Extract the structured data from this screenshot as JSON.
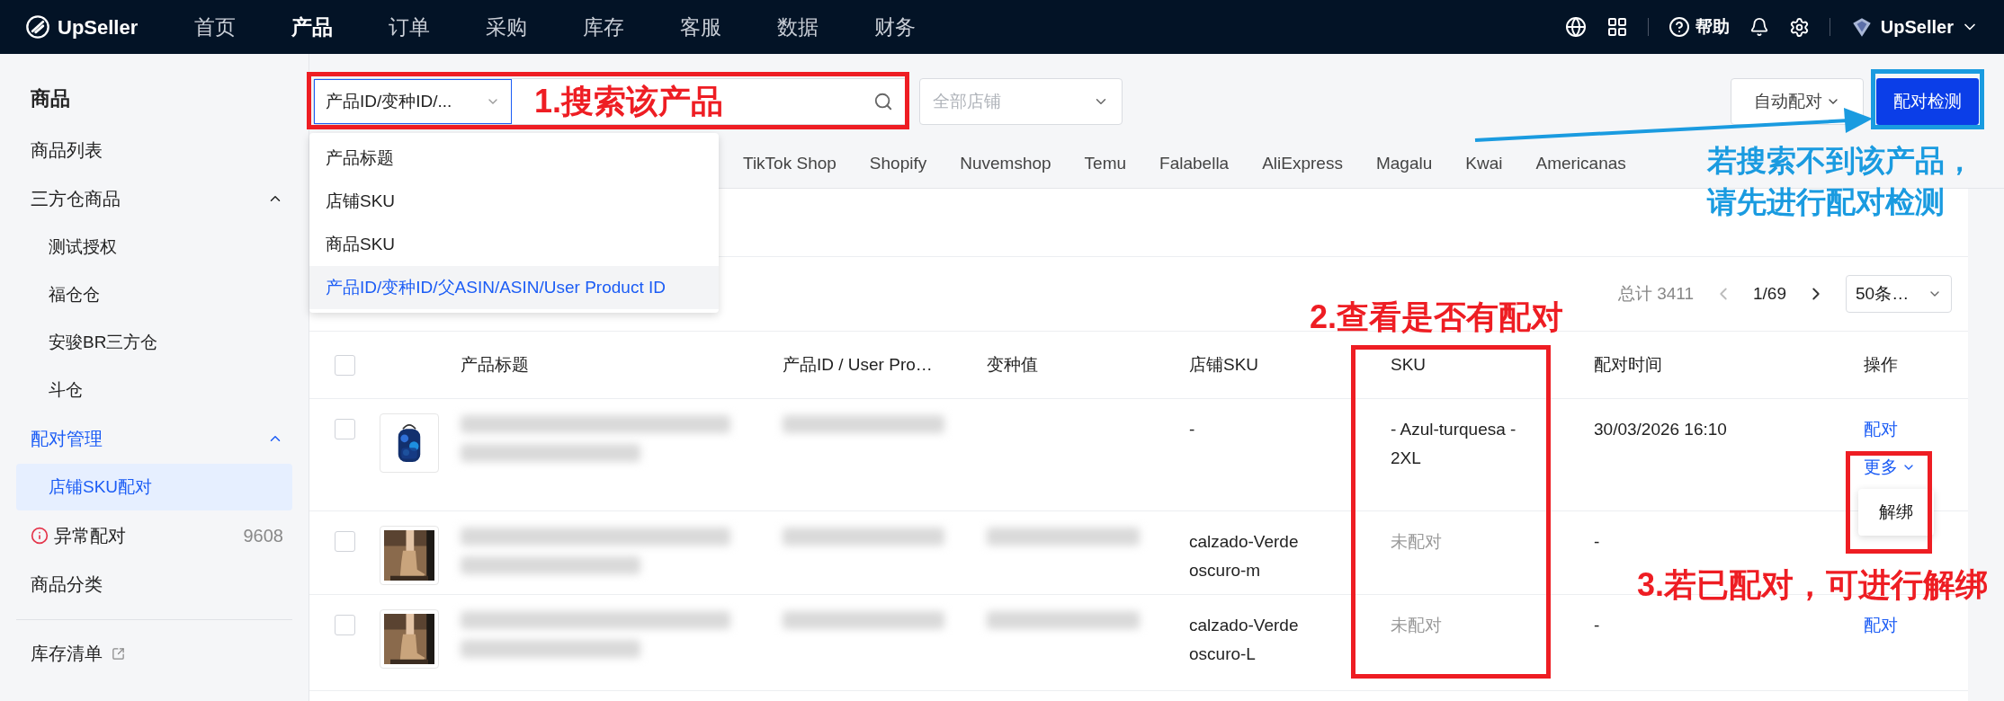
{
  "nav": {
    "logo": "UpSeller",
    "items": [
      {
        "label": "首页",
        "selected": false
      },
      {
        "label": "产品",
        "selected": true
      },
      {
        "label": "订单",
        "selected": false
      },
      {
        "label": "采购",
        "selected": false
      },
      {
        "label": "库存",
        "selected": false
      },
      {
        "label": "客服",
        "selected": false
      },
      {
        "label": "数据",
        "selected": false
      },
      {
        "label": "财务",
        "selected": false
      }
    ],
    "help": "帮助",
    "account": "UpSeller"
  },
  "sidebar": {
    "title": "商品",
    "items": [
      {
        "kind": "item",
        "label": "商品列表",
        "selected": false
      },
      {
        "kind": "group",
        "label": "三方仓商品",
        "selected": false,
        "expanded": true,
        "children": [
          {
            "label": "测试授权",
            "selected": false
          },
          {
            "label": "福仓仓",
            "selected": false
          },
          {
            "label": "安骏BR三方仓",
            "selected": false
          },
          {
            "label": "斗仓",
            "selected": false
          }
        ]
      },
      {
        "kind": "group",
        "label": "配对管理",
        "selected": true,
        "expanded": true,
        "children": [
          {
            "label": "店铺SKU配对",
            "selected": true
          }
        ]
      },
      {
        "kind": "alert",
        "label": "异常配对",
        "count": "9608",
        "selected": false
      },
      {
        "kind": "item",
        "label": "商品分类",
        "selected": false
      },
      {
        "kind": "link",
        "label": "库存清单",
        "selected": false
      }
    ]
  },
  "search": {
    "type_select": "产品ID/变种ID/...",
    "store_select": {
      "placeholder": "全部店铺"
    },
    "options": [
      {
        "label": "产品标题",
        "selected": false
      },
      {
        "label": "店铺SKU",
        "selected": false
      },
      {
        "label": "商品SKU",
        "selected": false
      },
      {
        "label": "产品ID/变种ID/父ASIN/ASIN/User Product ID",
        "selected": true
      }
    ]
  },
  "buttons": {
    "auto_pair": "自动配对",
    "pair_check": "配对检测"
  },
  "platform_tabs": [
    {
      "label": "TikTok Shop",
      "selected": false
    },
    {
      "label": "Shopify",
      "selected": false
    },
    {
      "label": "Nuvemshop",
      "selected": false
    },
    {
      "label": "Temu",
      "selected": false
    },
    {
      "label": "Falabella",
      "selected": false
    },
    {
      "label": "AliExpress",
      "selected": false
    },
    {
      "label": "Magalu",
      "selected": false
    },
    {
      "label": "Kwai",
      "selected": false
    },
    {
      "label": "Americanas",
      "selected": false
    }
  ],
  "pagination": {
    "total": "总计 3411",
    "page": "1/69",
    "page_size": "50条…"
  },
  "table": {
    "select_all": {
      "checked": false
    },
    "columns": [
      "产品标题",
      "产品ID / User Pro…",
      "变种值",
      "店铺SKU",
      "SKU",
      "配对时间",
      "操作"
    ],
    "rows": [
      {
        "checked": false,
        "thumbnail": {
          "kind": "picture"
        },
        "variant_blurred": false,
        "store_sku": "-",
        "sku": "- Azul-turquesa - 2XL",
        "paired": true,
        "paired_time": "30/03/2026 16:10",
        "actions": [
          {
            "label": "配对"
          }
        ],
        "more": {
          "label": "更多",
          "expanded": true,
          "menu": [
            {
              "label": "解绑"
            }
          ]
        }
      },
      {
        "checked": false,
        "thumbnail": {
          "kind": "picture"
        },
        "variant_blurred": true,
        "store_sku": "calzado-Verde oscuro-m",
        "sku": "未配对",
        "paired": false,
        "paired_time": "-",
        "actions": []
      },
      {
        "checked": false,
        "thumbnail": {
          "kind": "picture"
        },
        "variant_blurred": true,
        "store_sku": "calzado-Verde oscuro-L",
        "sku": "未配对",
        "paired": false,
        "paired_time": "-",
        "actions": [
          {
            "label": "配对"
          }
        ]
      }
    ]
  },
  "annotations": {
    "search_note": "1.搜索该产品",
    "check_note": [
      "若搜索不到该产品，",
      "请先进行配对检测"
    ],
    "pairing_note": "2.查看是否有配对",
    "unbind_note": "3.若已配对，可进行解绑"
  }
}
